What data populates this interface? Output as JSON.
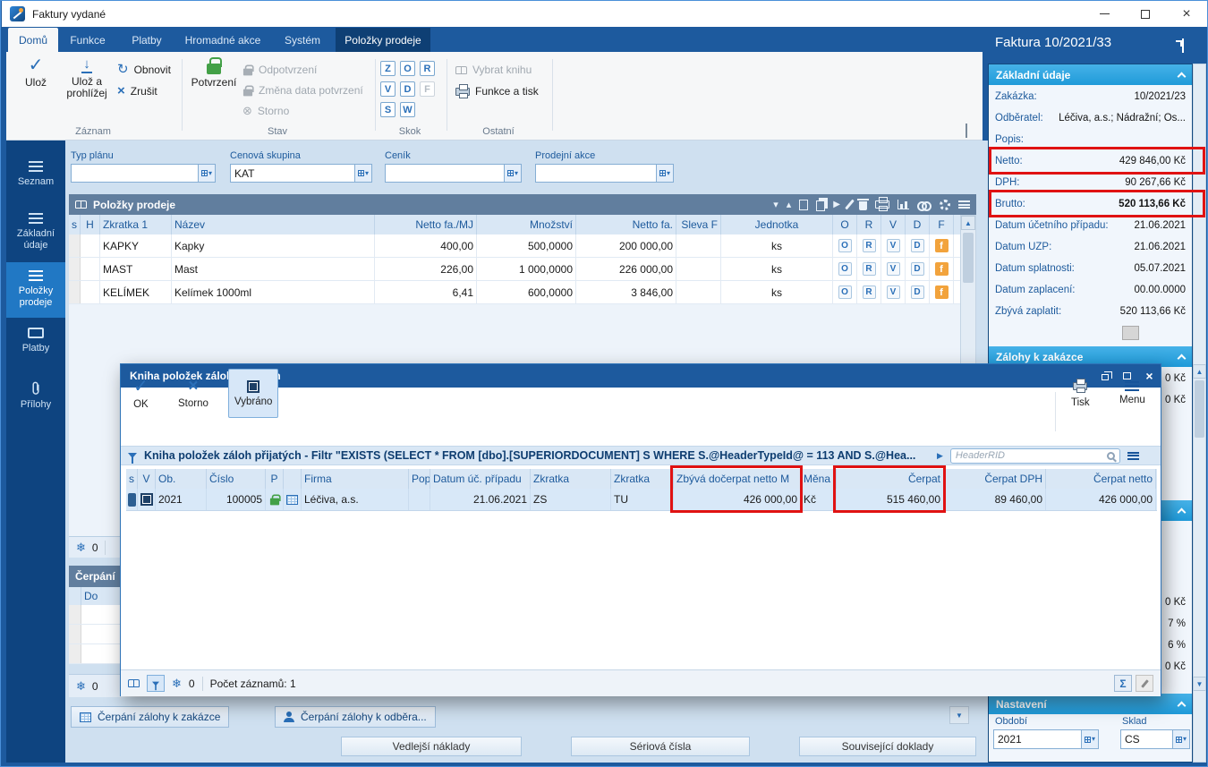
{
  "window": {
    "title": "Faktury vydané"
  },
  "tabs": [
    {
      "label": "Domů"
    },
    {
      "label": "Funkce"
    },
    {
      "label": "Platby"
    },
    {
      "label": "Hromadné akce"
    },
    {
      "label": "Systém"
    },
    {
      "label": "Položky prodeje"
    }
  ],
  "ribbon": {
    "save": "Ulož",
    "save_view": "Ulož a prohlížej",
    "refresh": "Obnovit",
    "cancel": "Zrušit",
    "confirm": "Potvrzení",
    "unconfirm": "Odpotvrzení",
    "change_date": "Změna data potvrzení",
    "storno": "Storno",
    "letters": [
      "Z",
      "O",
      "R",
      "V",
      "D",
      "F",
      "S",
      "W"
    ],
    "select_book": "Vybrat knihu",
    "func_print": "Funkce a tisk",
    "groups": {
      "record": "Záznam",
      "state": "Stav",
      "jump": "Skok",
      "other": "Ostatní"
    }
  },
  "sidebar": [
    {
      "label": "Seznam"
    },
    {
      "label": "Základní údaje"
    },
    {
      "label": "Položky prodeje"
    },
    {
      "label": "Platby"
    },
    {
      "label": "Přílohy"
    }
  ],
  "filters": [
    {
      "label": "Typ plánu",
      "value": ""
    },
    {
      "label": "Cenová skupina",
      "value": "KAT"
    },
    {
      "label": "Ceník",
      "value": ""
    },
    {
      "label": "Prodejní akce",
      "value": ""
    }
  ],
  "grid": {
    "title": "Položky prodeje",
    "cols": [
      "s",
      "H",
      "Zkratka 1",
      "Název",
      "Netto fa./MJ",
      "Množství",
      "Netto fa.",
      "Sleva F",
      "Jednotka",
      "O",
      "R",
      "V",
      "D",
      "F"
    ],
    "rows": [
      {
        "zkratka": "KAPKY",
        "nazev": "Kapky",
        "netto_mj": "400,00",
        "mnozstvi": "500,0000",
        "netto": "200 000,00",
        "jednotka": "ks"
      },
      {
        "zkratka": "MAST",
        "nazev": "Mast",
        "netto_mj": "226,00",
        "mnozstvi": "1 000,0000",
        "netto": "226 000,00",
        "jednotka": "ks"
      },
      {
        "zkratka": "KELÍMEK",
        "nazev": "Kelímek 1000ml",
        "netto_mj": "6,41",
        "mnozstvi": "600,0000",
        "netto": "3 846,00",
        "jednotka": "ks"
      }
    ],
    "flags": [
      "O",
      "R",
      "V",
      "D"
    ],
    "fflag": "f",
    "status_count": "0"
  },
  "cerpani": {
    "title": "Čerpání",
    "col": "Do",
    "status_count": "0"
  },
  "actions": {
    "zakazka": "Čerpání zálohy k zakázce",
    "odberatel": "Čerpání zálohy k odběra...",
    "vedlejsi": "Vedlejší náklady",
    "seriova": "Sériová čísla",
    "souvisejici": "Související doklady"
  },
  "dialog": {
    "title": "Kniha položek záloh přijatých",
    "ok": "OK",
    "storno": "Storno",
    "vybrano": "Vybráno",
    "tisk": "Tisk",
    "menu": "Menu",
    "filter_text": "Kniha položek záloh přijatých - Filtr \"EXISTS (SELECT * FROM [dbo].[SUPERIORDOCUMENT] S WHERE S.@HeaderTypeId@ = 113 AND S.@Hea...",
    "search_placeholder": "HeaderRID",
    "cols": [
      "s",
      "V",
      "Ob.",
      "Číslo",
      "P",
      "",
      "Firma",
      "Popi",
      "Datum úč. případu",
      "Zkratka",
      "Zkratka",
      "Zbývá dočerpat netto M",
      "Měna",
      "Čerpat",
      "Čerpat DPH",
      "Čerpat netto"
    ],
    "row": {
      "ob": "2021",
      "cislo": "100005",
      "firma": "Léčiva, a.s.",
      "popis": "",
      "datum": "21.06.2021",
      "zkr1": "ZS",
      "zkr2": "TU",
      "zbyva": "426 000,00",
      "mena": "Kč",
      "cerpat": "515 460,00",
      "cerpat_dph": "89 460,00",
      "cerpat_netto": "426 000,00"
    },
    "status_count_label": "Počet záznamů: 1",
    "snow_count": "0"
  },
  "panel": {
    "title": "Faktura 10/2021/33",
    "sec_zakladni": "Základní údaje",
    "sec_zalohy": "Zálohy k zakázce",
    "sec_nastaveni": "Nastavení",
    "fields": [
      {
        "label": "Zakázka:",
        "value": "10/2021/23"
      },
      {
        "label": "Odběratel:",
        "value": "Léčiva, a.s.; Nádražní; Os..."
      },
      {
        "label": "Popis:",
        "value": ""
      },
      {
        "label": "Netto:",
        "value": "429 846,00 Kč"
      },
      {
        "label": "DPH:",
        "value": "90 267,66 Kč"
      },
      {
        "label": "Brutto:",
        "value": "520 113,66 Kč"
      },
      {
        "label": "Datum účetního případu:",
        "value": "21.06.2021"
      },
      {
        "label": "Datum UZP:",
        "value": "21.06.2021"
      },
      {
        "label": "Datum splatnosti:",
        "value": "05.07.2021"
      },
      {
        "label": "Datum zaplacení:",
        "value": "00.00.0000"
      },
      {
        "label": "Zbývá zaplatit:",
        "value": "520 113,66 Kč"
      }
    ],
    "zalohy_partial": [
      "0 Kč",
      "0 Kč"
    ],
    "lower_partial": [
      "0 Kč",
      "7 %",
      "6 %",
      "0 Kč"
    ],
    "obdobi_label": "Období",
    "obdobi_value": "2021",
    "sklad_label": "Sklad",
    "sklad_value": "CS"
  },
  "icons": {
    "check": "✓",
    "close": "×",
    "refresh": "↻",
    "storno": "⊗",
    "snowflake": "❄",
    "sigma": "Σ",
    "caret_up": "▴",
    "caret_down": "▾",
    "arrow_up": "▲",
    "arrow_down": "▼",
    "arrow_right": "▶",
    "arrow_save": "↓"
  },
  "colors": {
    "ribbon_blue": "#1d5a9e",
    "header_cyan": "#2fa5e0",
    "slate": "#617e9e",
    "annotation_red": "#e01212",
    "flag_orange": "#f2a33c",
    "confirmed_green": "#43a047"
  }
}
